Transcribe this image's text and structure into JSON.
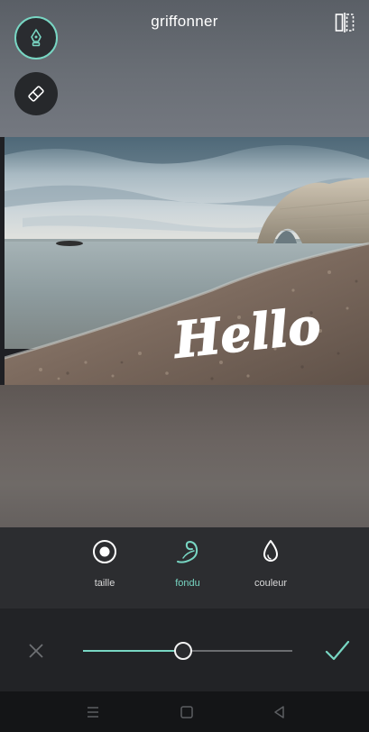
{
  "header": {
    "title": "griffonner"
  },
  "canvas": {
    "handwritten_text": "Hello"
  },
  "options": [
    {
      "label": "taille",
      "icon": "target-circle-icon",
      "active": false
    },
    {
      "label": "fondu",
      "icon": "feather-stroke-icon",
      "active": true
    },
    {
      "label": "couleur",
      "icon": "droplet-icon",
      "active": false
    }
  ],
  "slider": {
    "value": 0.48
  },
  "colors": {
    "accent": "#78d6c3",
    "panel": "#2c2d30",
    "slider_panel": "#222326",
    "navbar": "#141517"
  }
}
